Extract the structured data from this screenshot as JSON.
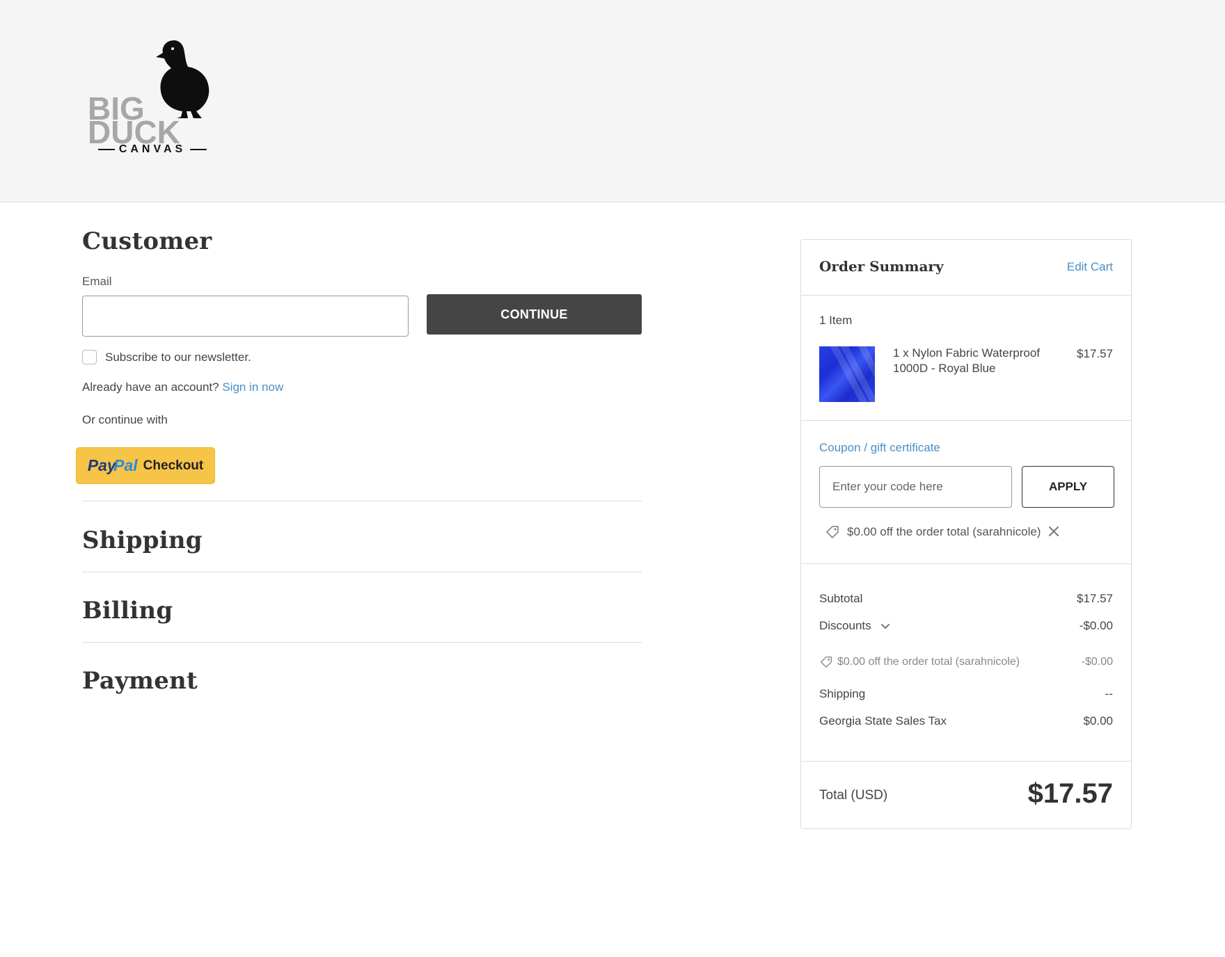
{
  "brand": {
    "logo_line1": "BIG",
    "logo_line2": "DUCK",
    "logo_line3": "CANVAS",
    "logo_tm": "™"
  },
  "customer": {
    "title": "Customer",
    "email_label": "Email",
    "email_value": "",
    "continue_label": "CONTINUE",
    "newsletter_label": "Subscribe to our newsletter.",
    "account_prompt": "Already have an account?",
    "sign_in_label": "Sign in now",
    "or_continue": "Or continue with",
    "paypal": {
      "pay": "Pay",
      "pal": "Pal",
      "checkout": "Checkout"
    }
  },
  "sections": {
    "shipping": "Shipping",
    "billing": "Billing",
    "payment": "Payment"
  },
  "summary": {
    "title": "Order Summary",
    "edit_cart": "Edit Cart",
    "item_count": "1 Item",
    "items": [
      {
        "name": "1 x Nylon Fabric Waterproof 1000D - Royal Blue",
        "price": "$17.57",
        "color": "#2a3fe0"
      }
    ],
    "coupon_link": "Coupon / gift certificate",
    "coupon_placeholder": "Enter your code here",
    "apply_label": "APPLY",
    "applied_coupon": "$0.00 off the order total (sarahnicole)",
    "subtotal_label": "Subtotal",
    "subtotal_value": "$17.57",
    "discounts_label": "Discounts",
    "discounts_value": "-$0.00",
    "discount_line_label": "$0.00 off the order total (sarahnicole)",
    "discount_line_value": "-$0.00",
    "shipping_label": "Shipping",
    "shipping_value": "--",
    "tax_label": "Georgia State Sales Tax",
    "tax_value": "$0.00",
    "total_label": "Total (USD)",
    "total_value": "$17.57"
  },
  "colors": {
    "accent_link": "#4a8fc7",
    "continue_bg": "#454545",
    "paypal_bg": "#f6c447"
  }
}
